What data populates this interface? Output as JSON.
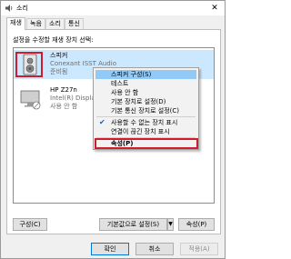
{
  "window": {
    "title": "소리",
    "close_glyph": "✕"
  },
  "tabs": [
    {
      "label": "재생",
      "active": true
    },
    {
      "label": "녹음",
      "active": false
    },
    {
      "label": "소리",
      "active": false
    },
    {
      "label": "통신",
      "active": false
    }
  ],
  "instructions": "설정을 수정할 재생 장치 선택:",
  "devices": [
    {
      "name": "스피커",
      "driver": "Conexant ISST Audio",
      "status": "준비됨",
      "icon": "speaker-icon"
    },
    {
      "name": "HP Z27n",
      "driver": "Intel(R) Display Audio",
      "status": "사용 안 함",
      "icon": "monitor-icon"
    }
  ],
  "context_menu": [
    {
      "label": "스피커 구성(S)",
      "highlighted": true
    },
    {
      "label": "테스트"
    },
    {
      "label": "사용 안 함"
    },
    {
      "label": "기본 장치로 설정(D)"
    },
    {
      "label": "기본 통신 장치로 설정(C)"
    },
    {
      "label": "사용할 수 없는 장치 표시",
      "checked": true
    },
    {
      "label": "연결이 끊긴 장치 표시"
    },
    {
      "label": "속성(P)"
    }
  ],
  "buttons": {
    "configure": "구성(C)",
    "set_default": "기본값으로 설정(S)",
    "properties": "속성(P)",
    "ok": "확인",
    "cancel": "취소",
    "apply": "적용(A)"
  },
  "colors": {
    "highlight_box": "#d11d2b",
    "selected_row": "#cce8ff",
    "menu_hover": "#91c9f7"
  }
}
